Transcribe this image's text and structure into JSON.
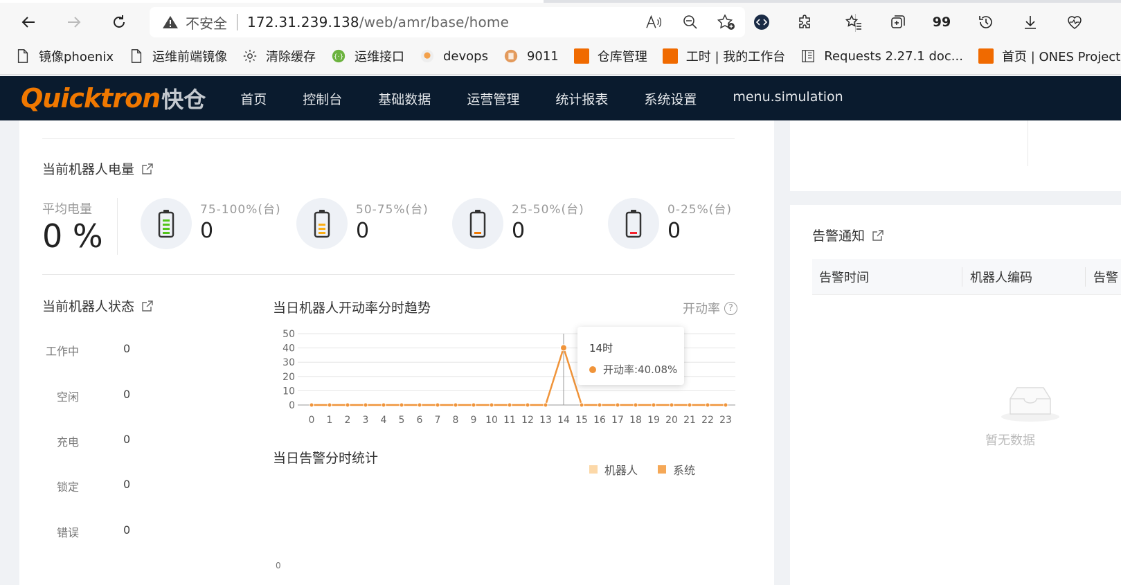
{
  "browser": {
    "address": {
      "security_label": "不安全",
      "host": "172.31.239.138",
      "path": "/web/amr/base/home"
    },
    "toolbar_glyphs": {
      "quote": "99"
    },
    "bookmarks": [
      {
        "label": "镜像phoenix",
        "icon": "page-icon"
      },
      {
        "label": "运维前端镜像",
        "icon": "page-icon"
      },
      {
        "label": "清除缓存",
        "icon": "gear-icon"
      },
      {
        "label": "运维接口",
        "icon": "api-icon"
      },
      {
        "label": "devops",
        "icon": "devops-icon"
      },
      {
        "label": "9011",
        "icon": "circle-icon"
      },
      {
        "label": "仓库管理",
        "icon": "quicktron-icon"
      },
      {
        "label": "工时 | 我的工作台",
        "icon": "quicktron-icon"
      },
      {
        "label": "Requests 2.27.1 doc...",
        "icon": "book-icon"
      },
      {
        "label": "首页 | ONES Project",
        "icon": "quicktron-icon"
      }
    ]
  },
  "app": {
    "logo_text": "Quicktron",
    "logo_cn": "快仓",
    "menu": [
      "首页",
      "控制台",
      "基础数据",
      "运营管理",
      "统计报表",
      "系统设置",
      "menu.simulation"
    ],
    "colors": {
      "accent": "#f07800",
      "header_bg": "#0a1b2e",
      "chart_line": "#f0943a"
    }
  },
  "battery": {
    "title": "当前机器人电量",
    "avg_label": "平均电量",
    "avg_value": "0 %",
    "groups": [
      {
        "range": "75-100%(台)",
        "count": "0",
        "color": "#52c41a",
        "level": 4
      },
      {
        "range": "50-75%(台)",
        "count": "0",
        "color": "#faad14",
        "level": 3
      },
      {
        "range": "25-50%(台)",
        "count": "0",
        "color": "#f07800",
        "level": 1
      },
      {
        "range": "0-25%(台)",
        "count": "0",
        "color": "#f5222d",
        "level": 1
      }
    ]
  },
  "robot_status": {
    "title": "当前机器人状态",
    "rows": [
      {
        "label": "工作中",
        "value": "0"
      },
      {
        "label": "空闲",
        "value": "0"
      },
      {
        "label": "充电",
        "value": "0"
      },
      {
        "label": "锁定",
        "value": "0"
      },
      {
        "label": "错误",
        "value": "0"
      }
    ]
  },
  "trend": {
    "title": "当日机器人开动率分时趋势",
    "rate_label": "开动率",
    "help": "?",
    "tooltip": {
      "title": "14时",
      "text": "开动率:40.08%"
    }
  },
  "chart_data": {
    "type": "line",
    "x": [
      0,
      1,
      2,
      3,
      4,
      5,
      6,
      7,
      8,
      9,
      10,
      11,
      12,
      13,
      14,
      15,
      16,
      17,
      18,
      19,
      20,
      21,
      22,
      23
    ],
    "series": [
      {
        "name": "开动率",
        "values": [
          0,
          0,
          0,
          0,
          0,
          0,
          0,
          0,
          0,
          0,
          0,
          0,
          0,
          0,
          40.08,
          0,
          0,
          0,
          0,
          0,
          0,
          0,
          0,
          0
        ]
      }
    ],
    "y_ticks": [
      0,
      10,
      20,
      30,
      40,
      50
    ],
    "ylim": [
      0,
      50
    ],
    "grid": true,
    "highlight_index": 14
  },
  "alarm_stats": {
    "title": "当日告警分时统计",
    "legend": [
      {
        "label": "机器人",
        "color": "#fcd8a8"
      },
      {
        "label": "系统",
        "color": "#f5a857"
      }
    ],
    "axis_zero": "0"
  },
  "alarm_notice": {
    "title": "告警通知",
    "columns": [
      "告警时间",
      "机器人编码",
      "告警"
    ],
    "empty_text": "暂无数据"
  }
}
